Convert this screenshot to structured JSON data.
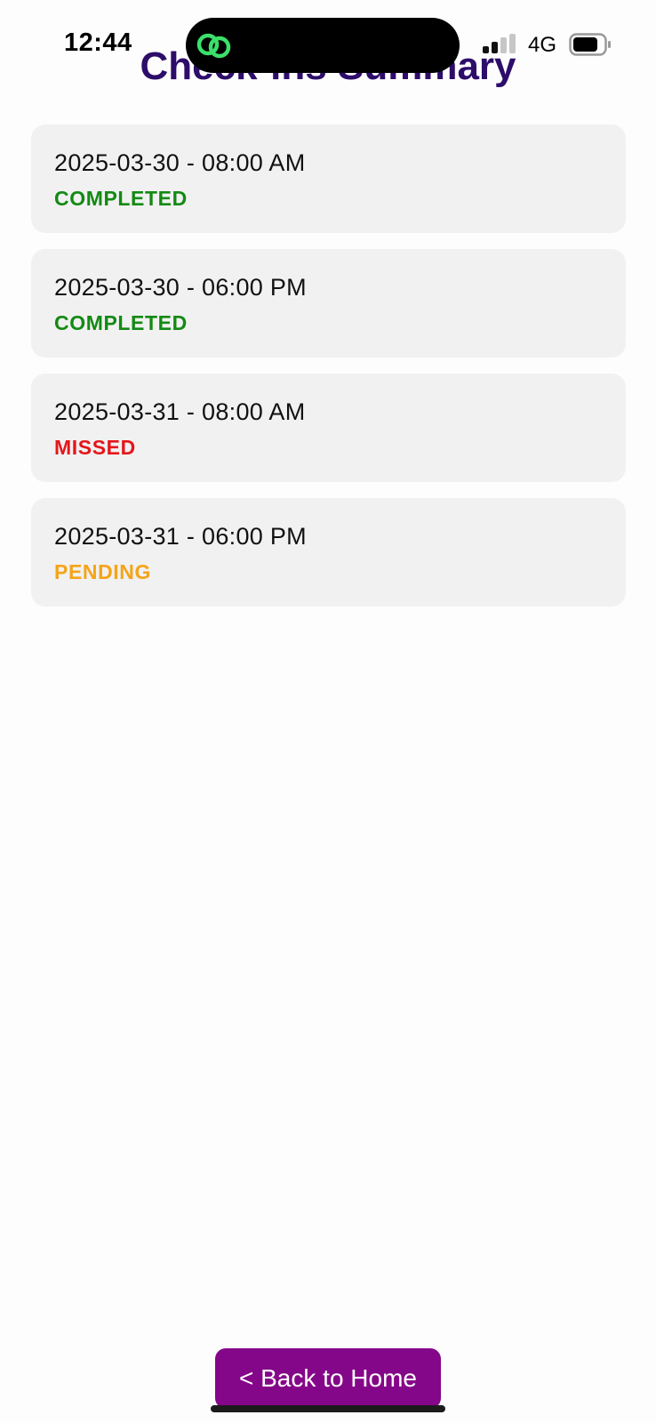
{
  "status_bar": {
    "time": "12:44",
    "network": "4G"
  },
  "header": {
    "title": "Check-ins Summary"
  },
  "checkins": [
    {
      "datetime": "2025-03-30 - 08:00 AM",
      "status": "COMPLETED",
      "status_color": "#138a13"
    },
    {
      "datetime": "2025-03-30 - 06:00 PM",
      "status": "COMPLETED",
      "status_color": "#138a13"
    },
    {
      "datetime": "2025-03-31 - 08:00 AM",
      "status": "MISSED",
      "status_color": "#e5161b"
    },
    {
      "datetime": "2025-03-31 - 06:00 PM",
      "status": "PENDING",
      "status_color": "#f5a418"
    }
  ],
  "footer": {
    "back_label": "< Back to Home"
  },
  "colors": {
    "title": "#2d0c6a",
    "button": "#850789",
    "card_bg": "#f1f1f1"
  },
  "icons": {
    "island_app": "chain-link-icon",
    "signal": "cellular-signal-icon",
    "battery": "battery-icon"
  }
}
